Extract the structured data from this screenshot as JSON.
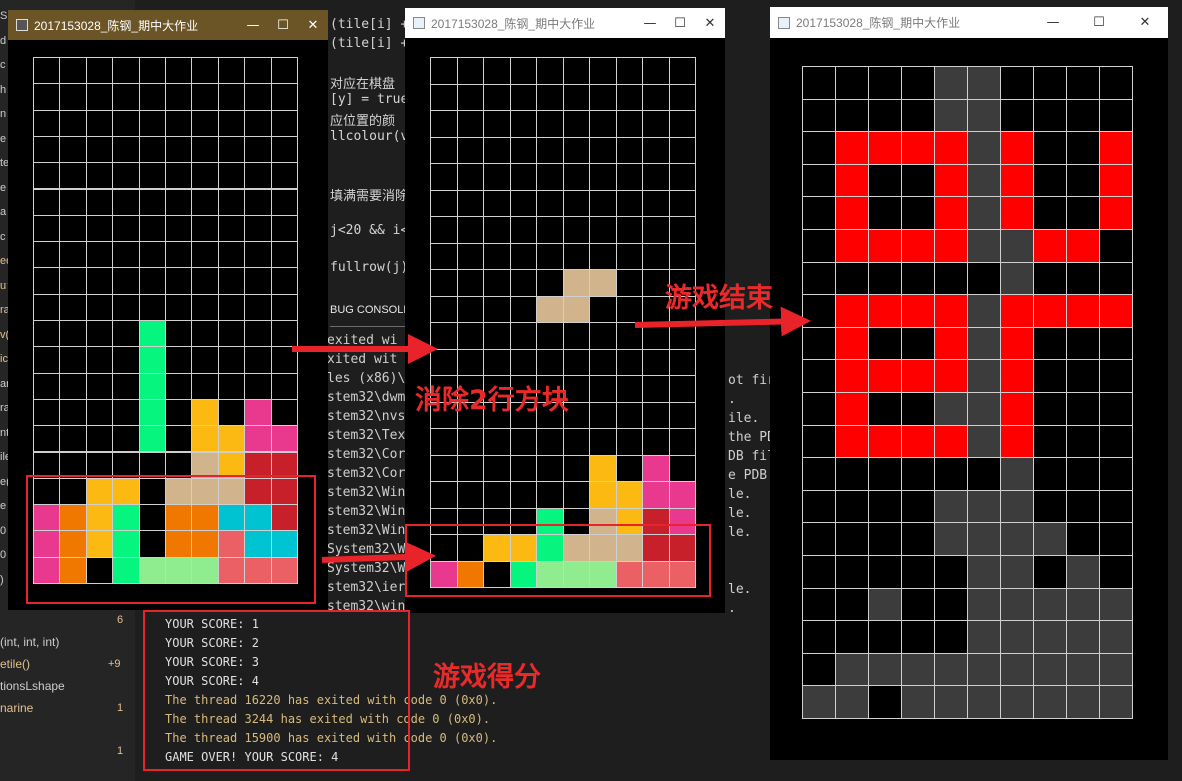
{
  "editor": {
    "code_lines": [
      {
        "text": "(tile[i] +"
      },
      {
        "text": "(tile[i] +"
      },
      {
        "text": ""
      },
      {
        "text": "对应在棋盘"
      },
      {
        "text": "[y] = true"
      },
      {
        "text": "应位置的颜"
      },
      {
        "text": "llcolour(v"
      },
      {
        "text": ""
      },
      {
        "text": ""
      },
      {
        "text": "填满需要消除"
      },
      {
        "text": ""
      },
      {
        "text": "j<20 && i<"
      },
      {
        "text": ""
      },
      {
        "text": "fullrow(j)"
      }
    ],
    "panel_tab": "BUG CONSOLE",
    "output_lines": [
      {
        "text": "exited wi"
      },
      {
        "text": "xited wit"
      },
      {
        "text": "les (x86)\\"
      },
      {
        "text": "stem32\\dwm"
      },
      {
        "text": "stem32\\nvs"
      },
      {
        "text": "stem32\\Tex"
      },
      {
        "text": "stem32\\Cor"
      },
      {
        "text": "stem32\\Cor"
      },
      {
        "text": "stem32\\Win"
      },
      {
        "text": "stem32\\Win"
      },
      {
        "text": "stem32\\Win"
      },
      {
        "text": "System32\\W"
      },
      {
        "text": "System32\\W"
      },
      {
        "text": "stem32\\ier"
      },
      {
        "text": "stem32\\win"
      }
    ],
    "output_right_lines": [
      {
        "text": "ot fir"
      },
      {
        "text": "."
      },
      {
        "text": "ile."
      },
      {
        "text": "the PD"
      },
      {
        "text": "DB fil"
      },
      {
        "text": "e PDB"
      },
      {
        "text": "le."
      },
      {
        "text": "le."
      },
      {
        "text": "le."
      },
      {
        "text": ""
      },
      {
        "text": ""
      },
      {
        "text": "le."
      },
      {
        "text": "."
      }
    ]
  },
  "outline": {
    "items": [
      {
        "label": "(int, int, int)",
        "count": ""
      },
      {
        "label": "etile()",
        "count": "+9"
      },
      {
        "label": "tionsLshape",
        "count": ""
      },
      {
        "label": "narine",
        "count": "1"
      }
    ],
    "bottom_count": "1",
    "top_count": "6",
    "edge_glyphs": [
      "S",
      "d",
      "c",
      "h",
      "n",
      "e",
      "te",
      "e",
      "a",
      "c",
      "ed",
      "u",
      "ra",
      "v(",
      "ic",
      "ar",
      "ra",
      "nt",
      "ile",
      "e(",
      "e",
      "0",
      "0",
      ")"
    ]
  },
  "windows": [
    {
      "title": "2017153028_陈钢_期中大作业",
      "active": true
    },
    {
      "title": "2017153028_陈钢_期中大作业",
      "active": false
    },
    {
      "title": "2017153028_陈钢_期中大作业",
      "active": false
    }
  ],
  "controls": {
    "minimize": "—",
    "maximize": "☐",
    "close": "✕"
  },
  "boards": [
    {
      "rows": 20,
      "cols": 10,
      "cells": [
        [
          4,
          10,
          "#05f57e"
        ],
        [
          4,
          11,
          "#05f57e"
        ],
        [
          4,
          12,
          "#05f57e"
        ],
        [
          4,
          13,
          "#05f57e"
        ],
        [
          4,
          14,
          "#05f57e"
        ],
        [
          6,
          13,
          "#fbb912"
        ],
        [
          8,
          13,
          "#e8398e"
        ],
        [
          6,
          14,
          "#fbb912"
        ],
        [
          7,
          14,
          "#fbb912"
        ],
        [
          8,
          14,
          "#e8398e"
        ],
        [
          9,
          14,
          "#e8398e"
        ],
        [
          6,
          15,
          "#d2b48c"
        ],
        [
          7,
          15,
          "#fbb912"
        ],
        [
          8,
          15,
          "#c8202a"
        ],
        [
          9,
          15,
          "#c8202a"
        ],
        [
          2,
          16,
          "#fbb912"
        ],
        [
          3,
          16,
          "#fbb912"
        ],
        [
          5,
          16,
          "#d2b48c"
        ],
        [
          6,
          16,
          "#d2b48c"
        ],
        [
          7,
          16,
          "#d2b48c"
        ],
        [
          8,
          16,
          "#c8202a"
        ],
        [
          9,
          16,
          "#c8202a"
        ],
        [
          0,
          17,
          "#e8398e"
        ],
        [
          1,
          17,
          "#f07800"
        ],
        [
          2,
          17,
          "#fbb912"
        ],
        [
          3,
          17,
          "#05f57e"
        ],
        [
          5,
          17,
          "#f07800"
        ],
        [
          6,
          17,
          "#f07800"
        ],
        [
          7,
          17,
          "#00c3d2"
        ],
        [
          8,
          17,
          "#00c3d2"
        ],
        [
          9,
          17,
          "#c8202a"
        ],
        [
          0,
          18,
          "#e8398e"
        ],
        [
          1,
          18,
          "#f07800"
        ],
        [
          2,
          18,
          "#fbb912"
        ],
        [
          3,
          18,
          "#05f57e"
        ],
        [
          5,
          18,
          "#f07800"
        ],
        [
          6,
          18,
          "#f07800"
        ],
        [
          7,
          18,
          "#eb6064"
        ],
        [
          8,
          18,
          "#00c3d2"
        ],
        [
          9,
          18,
          "#00c3d2"
        ],
        [
          0,
          19,
          "#e8398e"
        ],
        [
          1,
          19,
          "#f07800"
        ],
        [
          3,
          19,
          "#05f57e"
        ],
        [
          4,
          19,
          "#8fed8f"
        ],
        [
          5,
          19,
          "#8fed8f"
        ],
        [
          6,
          19,
          "#8fed8f"
        ],
        [
          7,
          19,
          "#eb6064"
        ],
        [
          8,
          19,
          "#eb6064"
        ],
        [
          9,
          19,
          "#eb6064"
        ]
      ]
    },
    {
      "rows": 20,
      "cols": 10,
      "cells": [
        [
          5,
          8,
          "#d2b48c"
        ],
        [
          6,
          8,
          "#d2b48c"
        ],
        [
          4,
          9,
          "#d2b48c"
        ],
        [
          5,
          9,
          "#d2b48c"
        ],
        [
          6,
          15,
          "#fbb912"
        ],
        [
          8,
          15,
          "#e8398e"
        ],
        [
          6,
          16,
          "#fbb912"
        ],
        [
          7,
          16,
          "#fbb912"
        ],
        [
          8,
          16,
          "#e8398e"
        ],
        [
          9,
          16,
          "#e8398e"
        ],
        [
          4,
          17,
          "#05f57e"
        ],
        [
          6,
          17,
          "#d2b48c"
        ],
        [
          7,
          17,
          "#fbb912"
        ],
        [
          8,
          17,
          "#c8202a"
        ],
        [
          9,
          17,
          "#e8398e"
        ],
        [
          2,
          18,
          "#fbb912"
        ],
        [
          3,
          18,
          "#fbb912"
        ],
        [
          4,
          18,
          "#05f57e"
        ],
        [
          5,
          18,
          "#d2b48c"
        ],
        [
          6,
          18,
          "#d2b48c"
        ],
        [
          7,
          18,
          "#d2b48c"
        ],
        [
          8,
          18,
          "#c8202a"
        ],
        [
          9,
          18,
          "#c8202a"
        ],
        [
          0,
          19,
          "#e8398e"
        ],
        [
          1,
          19,
          "#f07800"
        ],
        [
          3,
          19,
          "#05f57e"
        ],
        [
          4,
          19,
          "#8fed8f"
        ],
        [
          5,
          19,
          "#8fed8f"
        ],
        [
          6,
          19,
          "#8fed8f"
        ],
        [
          7,
          19,
          "#eb6064"
        ],
        [
          8,
          19,
          "#eb6064"
        ],
        [
          9,
          19,
          "#eb6064"
        ]
      ]
    },
    {
      "rows": 20,
      "cols": 10,
      "cells": [
        [
          4,
          0,
          "#3c3c3c"
        ],
        [
          5,
          0,
          "#3c3c3c"
        ],
        [
          4,
          1,
          "#3c3c3c"
        ],
        [
          5,
          1,
          "#3c3c3c"
        ],
        [
          1,
          2,
          "#ff0000"
        ],
        [
          2,
          2,
          "#ff0000"
        ],
        [
          3,
          2,
          "#ff0000"
        ],
        [
          4,
          2,
          "#ff0000"
        ],
        [
          5,
          2,
          "#3c3c3c"
        ],
        [
          6,
          2,
          "#ff0000"
        ],
        [
          9,
          2,
          "#ff0000"
        ],
        [
          1,
          3,
          "#ff0000"
        ],
        [
          4,
          3,
          "#ff0000"
        ],
        [
          5,
          3,
          "#3c3c3c"
        ],
        [
          6,
          3,
          "#ff0000"
        ],
        [
          9,
          3,
          "#ff0000"
        ],
        [
          1,
          4,
          "#ff0000"
        ],
        [
          4,
          4,
          "#ff0000"
        ],
        [
          5,
          4,
          "#3c3c3c"
        ],
        [
          6,
          4,
          "#ff0000"
        ],
        [
          9,
          4,
          "#ff0000"
        ],
        [
          1,
          5,
          "#ff0000"
        ],
        [
          2,
          5,
          "#ff0000"
        ],
        [
          3,
          5,
          "#ff0000"
        ],
        [
          4,
          5,
          "#ff0000"
        ],
        [
          5,
          5,
          "#3c3c3c"
        ],
        [
          6,
          5,
          "#3c3c3c"
        ],
        [
          7,
          5,
          "#ff0000"
        ],
        [
          8,
          5,
          "#ff0000"
        ],
        [
          6,
          6,
          "#3c3c3c"
        ],
        [
          1,
          7,
          "#ff0000"
        ],
        [
          2,
          7,
          "#ff0000"
        ],
        [
          3,
          7,
          "#ff0000"
        ],
        [
          4,
          7,
          "#ff0000"
        ],
        [
          5,
          7,
          "#3c3c3c"
        ],
        [
          6,
          7,
          "#ff0000"
        ],
        [
          7,
          7,
          "#ff0000"
        ],
        [
          8,
          7,
          "#ff0000"
        ],
        [
          9,
          7,
          "#ff0000"
        ],
        [
          1,
          8,
          "#ff0000"
        ],
        [
          4,
          8,
          "#ff0000"
        ],
        [
          5,
          8,
          "#3c3c3c"
        ],
        [
          6,
          8,
          "#ff0000"
        ],
        [
          1,
          9,
          "#ff0000"
        ],
        [
          2,
          9,
          "#ff0000"
        ],
        [
          3,
          9,
          "#ff0000"
        ],
        [
          4,
          9,
          "#ff0000"
        ],
        [
          5,
          9,
          "#3c3c3c"
        ],
        [
          6,
          9,
          "#ff0000"
        ],
        [
          1,
          10,
          "#ff0000"
        ],
        [
          4,
          10,
          "#3c3c3c"
        ],
        [
          5,
          10,
          "#3c3c3c"
        ],
        [
          6,
          10,
          "#ff0000"
        ],
        [
          1,
          11,
          "#ff0000"
        ],
        [
          2,
          11,
          "#ff0000"
        ],
        [
          3,
          11,
          "#ff0000"
        ],
        [
          4,
          11,
          "#ff0000"
        ],
        [
          5,
          11,
          "#3c3c3c"
        ],
        [
          6,
          11,
          "#ff0000"
        ],
        [
          6,
          12,
          "#3c3c3c"
        ],
        [
          4,
          13,
          "#3c3c3c"
        ],
        [
          5,
          13,
          "#3c3c3c"
        ],
        [
          6,
          13,
          "#3c3c3c"
        ],
        [
          4,
          14,
          "#3c3c3c"
        ],
        [
          5,
          14,
          "#3c3c3c"
        ],
        [
          6,
          14,
          "#3c3c3c"
        ],
        [
          7,
          14,
          "#3c3c3c"
        ],
        [
          5,
          15,
          "#3c3c3c"
        ],
        [
          6,
          15,
          "#3c3c3c"
        ],
        [
          8,
          15,
          "#3c3c3c"
        ],
        [
          2,
          16,
          "#3c3c3c"
        ],
        [
          5,
          16,
          "#3c3c3c"
        ],
        [
          6,
          16,
          "#3c3c3c"
        ],
        [
          7,
          16,
          "#3c3c3c"
        ],
        [
          8,
          16,
          "#3c3c3c"
        ],
        [
          9,
          16,
          "#3c3c3c"
        ],
        [
          5,
          17,
          "#3c3c3c"
        ],
        [
          6,
          17,
          "#3c3c3c"
        ],
        [
          7,
          17,
          "#3c3c3c"
        ],
        [
          8,
          17,
          "#3c3c3c"
        ],
        [
          9,
          17,
          "#3c3c3c"
        ],
        [
          1,
          18,
          "#3c3c3c"
        ],
        [
          2,
          18,
          "#3c3c3c"
        ],
        [
          3,
          18,
          "#3c3c3c"
        ],
        [
          4,
          18,
          "#3c3c3c"
        ],
        [
          5,
          18,
          "#3c3c3c"
        ],
        [
          6,
          18,
          "#3c3c3c"
        ],
        [
          7,
          18,
          "#3c3c3c"
        ],
        [
          8,
          18,
          "#3c3c3c"
        ],
        [
          9,
          18,
          "#3c3c3c"
        ],
        [
          0,
          19,
          "#3c3c3c"
        ],
        [
          1,
          19,
          "#3c3c3c"
        ],
        [
          3,
          19,
          "#3c3c3c"
        ],
        [
          4,
          19,
          "#3c3c3c"
        ],
        [
          5,
          19,
          "#3c3c3c"
        ],
        [
          6,
          19,
          "#3c3c3c"
        ],
        [
          7,
          19,
          "#3c3c3c"
        ],
        [
          8,
          19,
          "#3c3c3c"
        ],
        [
          9,
          19,
          "#3c3c3c"
        ]
      ]
    }
  ],
  "console": {
    "lines": [
      {
        "text": "YOUR SCORE: 1",
        "kind": "plain"
      },
      {
        "text": "YOUR SCORE: 2",
        "kind": "plain"
      },
      {
        "text": "YOUR SCORE: 3",
        "kind": "plain"
      },
      {
        "text": "YOUR SCORE: 4",
        "kind": "plain"
      },
      {
        "text": "The thread 16220 has exited with code 0 (0x0).",
        "kind": "thread"
      },
      {
        "text": "The thread 3244 has exited with code 0 (0x0).",
        "kind": "thread"
      },
      {
        "text": "The thread 15900 has exited with code 0 (0x0).",
        "kind": "thread"
      },
      {
        "text": "GAME OVER! YOUR SCORE: 4",
        "kind": "plain"
      }
    ]
  },
  "annotations": {
    "clear_rows": "消除2行方块",
    "game_over": "游戏结束",
    "score": "游戏得分"
  },
  "colors": {
    "annotation_red": "#e8242a",
    "accent_title": "#6b5425"
  }
}
